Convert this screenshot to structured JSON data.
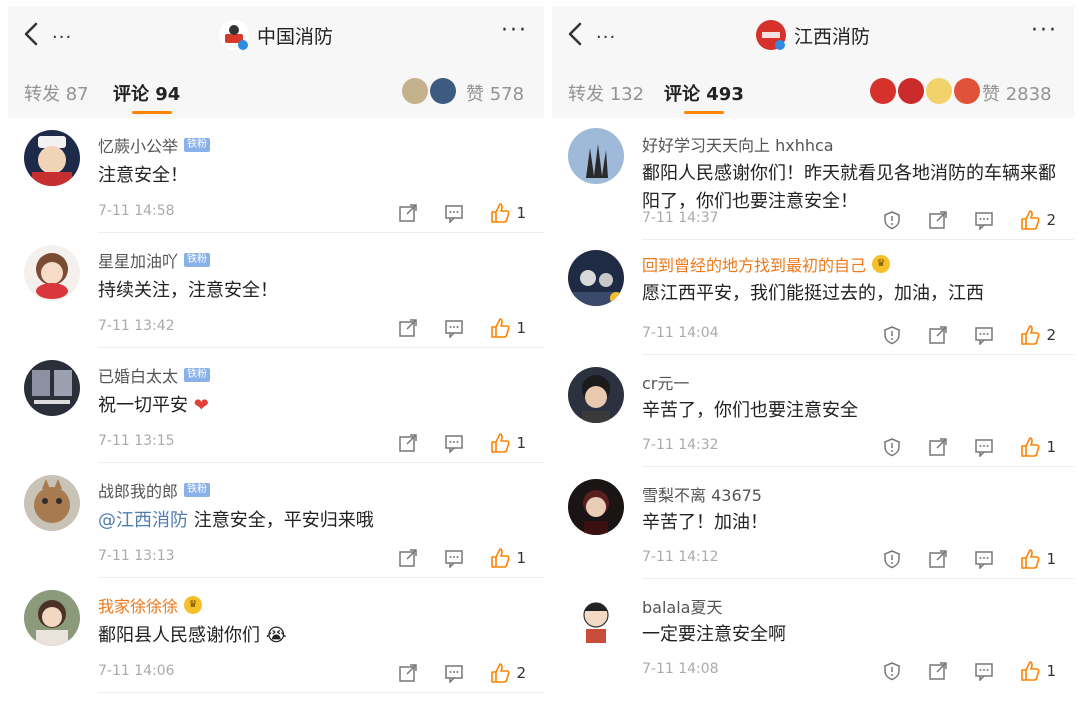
{
  "left": {
    "nav": {
      "back_dots": "...",
      "account": "中国消防",
      "more": "···"
    },
    "tabs": {
      "repost": "转发 87",
      "comments": "评论 94",
      "likes": "赞 578"
    },
    "comments": [
      {
        "user": "忆蕨小公举",
        "badge": "铁粉",
        "text": "注意安全！",
        "time": "7-11 14:58",
        "likes": "1"
      },
      {
        "user": "星星加油吖",
        "badge": "铁粉",
        "text": "持续关注，注意安全！",
        "time": "7-11 13:42",
        "likes": "1"
      },
      {
        "user": "已婚白太太",
        "badge": "铁粉",
        "text": "祝一切平安",
        "emoji": "❤",
        "time": "7-11 13:15",
        "likes": "1"
      },
      {
        "user": "战郎我的郎",
        "badge": "铁粉",
        "mention": "@江西消防",
        "text": "注意安全，平安归来哦",
        "time": "7-11 13:13",
        "likes": "1"
      },
      {
        "user": "我家徐徐徐",
        "text": "鄱阳县人民感谢你们",
        "emoji": "😭",
        "time": "7-11 14:06",
        "likes": "2"
      }
    ]
  },
  "right": {
    "nav": {
      "back_dots": "...",
      "account": "江西消防",
      "more": "···"
    },
    "tabs": {
      "repost": "转发 132",
      "comments": "评论 493",
      "likes": "赞 2838"
    },
    "comments": [
      {
        "user": "好好学习天天向上 hxhhca",
        "text": "鄱阳人民感谢你们！昨天就看见各地消防的车辆来鄱阳了，你们也要注意安全！",
        "time": "7-11 14:37",
        "likes": "2"
      },
      {
        "user": "回到曾经的地方找到最初的自己",
        "text": "愿江西平安，我们能挺过去的，加油，江西",
        "time": "7-11 14:04",
        "likes": "2"
      },
      {
        "user": "cr元一",
        "text": "辛苦了，你们也要注意安全",
        "time": "7-11 14:32",
        "likes": "1"
      },
      {
        "user": "雪梨不离 43675",
        "text": "辛苦了！加油！",
        "time": "7-11 14:12",
        "likes": "1"
      },
      {
        "user": "balala夏天",
        "text": "一定要注意安全啊",
        "time": "7-11 14:08",
        "likes": "1"
      }
    ]
  },
  "colors": {
    "accent": "#ff8200",
    "mention": "#507daf",
    "vip_name": "#f07818",
    "fan_badge": "#89b0e8"
  }
}
